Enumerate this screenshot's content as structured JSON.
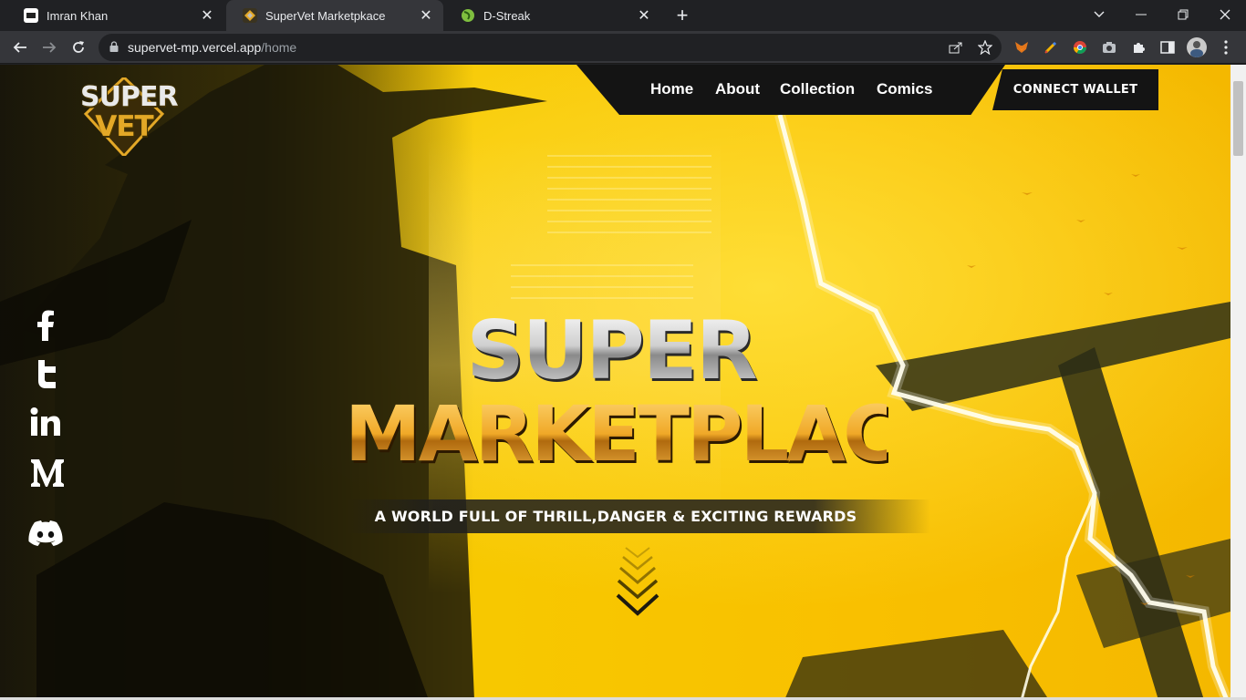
{
  "browser": {
    "tabs": [
      {
        "title": "Imran Khan",
        "active": false,
        "favicon": "imran-khan-favicon"
      },
      {
        "title": "SuperVet Marketpkace",
        "active": true,
        "favicon": "supervet-favicon"
      },
      {
        "title": "D-Streak",
        "active": false,
        "favicon": "d-streak-favicon"
      }
    ],
    "close_glyph": "✕",
    "new_tab_glyph": "+",
    "url": {
      "host": "supervet-mp.vercel.app",
      "path": "/home"
    },
    "window_controls": [
      "chevron-down-icon",
      "minimize-icon",
      "restore-icon",
      "close-icon"
    ],
    "extensions": [
      "share-icon",
      "star-icon",
      "metamask-icon",
      "pen-icon",
      "chrome-circle-icon",
      "camera-icon",
      "puzzle-icon",
      "sidepanel-icon",
      "profile-avatar",
      "kebab-menu-icon"
    ]
  },
  "site": {
    "logo": {
      "line1": "SUPER",
      "line2": "VET"
    },
    "nav": {
      "home": "Home",
      "about": "About",
      "collection": "Collection",
      "comics": "Comics"
    },
    "connect_wallet": "CONNECT WALLET",
    "socials": [
      "facebook-icon",
      "twitter-icon",
      "linkedin-icon",
      "medium-icon",
      "discord-icon"
    ],
    "hero": {
      "title_line1": "SUPER",
      "title_line2": "MARKETPLACE",
      "tagline": "A WORLD FULL OF THRILL,DANGER & EXCITING REWARDS"
    },
    "colors": {
      "accent_yellow": "#f7c400",
      "dark": "#141414",
      "gold": "#e3a827"
    }
  }
}
